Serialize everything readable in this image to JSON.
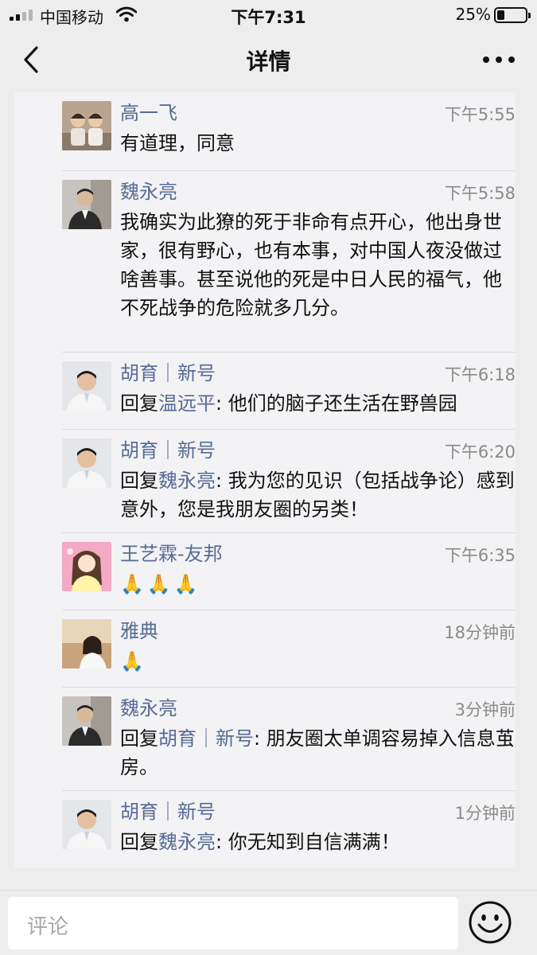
{
  "status_bar": {
    "carrier": "中国移动",
    "time": "下午7:31",
    "battery": "25%"
  },
  "nav": {
    "title": "详情"
  },
  "comments": [
    {
      "name": "高一飞",
      "time": "下午5:55",
      "text": "有道理，同意"
    },
    {
      "name": "魏永亮",
      "time": "下午5:58",
      "text": "我确实为此獠的死于非命有点开心，他出身世家，很有野心，也有本事，对中国人夜没做过啥善事。甚至说他的死是中日人民的福气，他不死战争的危险就多几分。"
    },
    {
      "name": "胡育｜新号",
      "time": "下午6:18",
      "reply_prefix": "回复",
      "reply_to": "温远平",
      "text": ": 他们的脑子还生活在野兽园"
    },
    {
      "name": "胡育｜新号",
      "time": "下午6:20",
      "reply_prefix": "回复",
      "reply_to": "魏永亮",
      "text": ": 我为您的见识（包括战争论）感到意外，您是我朋友圈的另类！"
    },
    {
      "name": "王艺霖-友邦",
      "time": "下午6:35",
      "emoji": "🙏"
    },
    {
      "name": "雅典",
      "time": "18分钟前",
      "emoji": "🙏"
    },
    {
      "name": "魏永亮",
      "time": "3分钟前",
      "reply_prefix": "回复",
      "reply_to": "胡育｜新号",
      "text": ": 朋友圈太单调容易掉入信息茧房。"
    },
    {
      "name": "胡育｜新号",
      "time": "1分钟前",
      "reply_prefix": "回复",
      "reply_to": "魏永亮",
      "text": ": 你无知到自信满满！"
    }
  ],
  "input": {
    "placeholder": "评论"
  }
}
